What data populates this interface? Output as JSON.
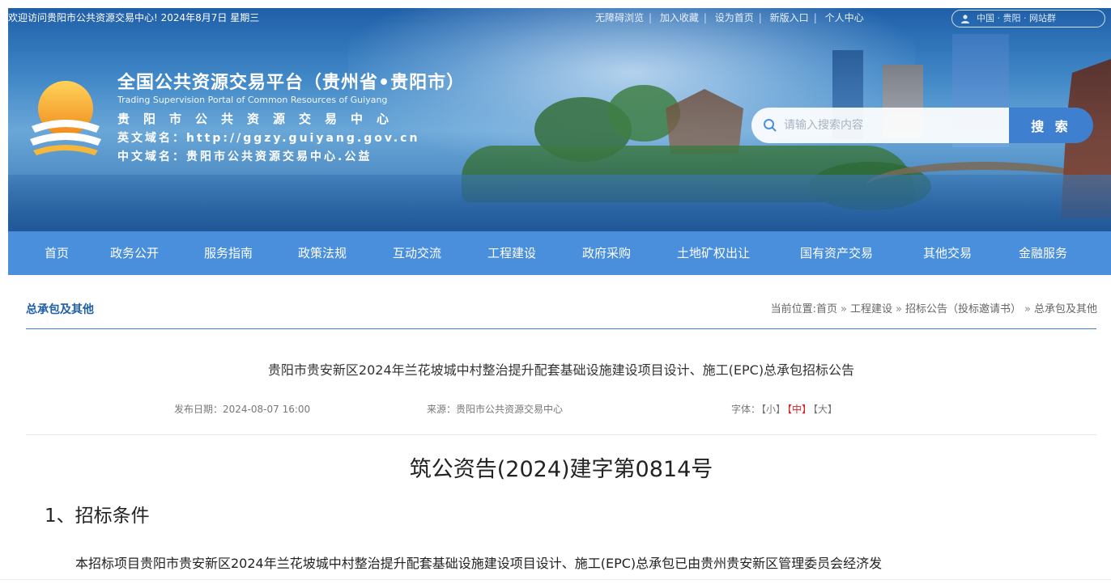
{
  "topbar": {
    "welcome": "欢迎访问贵阳市公共资源交易中心!   2024年8月7日 星期三",
    "links": [
      "无障碍浏览",
      "加入收藏",
      "设为首页",
      "新版入口",
      "个人中心"
    ],
    "login_text": "中国 · 贵阳 · 网站群"
  },
  "header": {
    "title_cn": "全国公共资源交易平台（贵州省•贵阳市）",
    "title_en": "Trading Supervision Portal of Common Resources of Guiyang",
    "center_name": "贵阳市公共资源交易中心",
    "domain_en": "英文域名：http://ggzy.guiyang.gov.cn",
    "domain_cn": "中文域名：贵阳市公共资源交易中心.公益"
  },
  "search": {
    "placeholder": "请输入搜索内容",
    "button_label": "搜 索"
  },
  "nav": {
    "items": [
      "首页",
      "政务公开",
      "服务指南",
      "政策法规",
      "互动交流",
      "工程建设",
      "政府采购",
      "土地矿权出让",
      "国有资产交易",
      "其他交易",
      "金融服务"
    ]
  },
  "breadcrumb": {
    "section_title": "总承包及其他",
    "prefix": "当前位置:",
    "items": [
      "首页",
      "工程建设",
      "招标公告（投标邀请书）",
      "总承包及其他"
    ]
  },
  "article": {
    "title": "贵阳市贵安新区2024年兰花坡城中村整治提升配套基础设施建设项目设计、施工(EPC)总承包招标公告",
    "date_label": "发布日期：",
    "date": "2024-08-07 16:00",
    "source_label": "来源：",
    "source": "贵阳市公共资源交易中心",
    "font_label": "字体：",
    "font_small": "【小】",
    "font_medium": "【中】",
    "font_large": "【大】",
    "doc_number": "筑公资告(2024)建字第0814号",
    "section_heading": "1、招标条件",
    "paragraph": "本招标项目贵阳市贵安新区2024年兰花坡城中村整治提升配套基础设施建设项目设计、施工(EPC)总承包已由贵州贵安新区管理委员会经济发"
  },
  "colors": {
    "nav_bg": "#4a8fdb",
    "accent": "#1f5fa8",
    "font_active": "#dd2222"
  }
}
